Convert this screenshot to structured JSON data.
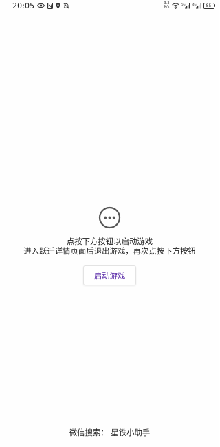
{
  "status_bar": {
    "time": "20:05",
    "net_speed_value": "3.3",
    "net_speed_unit": "K/s",
    "battery_level": "85",
    "icons": [
      "eye-icon",
      "nfc-icon",
      "location-icon",
      "mute-icon",
      "wifi-icon",
      "signal-icon",
      "signal-icon",
      "battery-icon"
    ],
    "signal_label_1": "5G",
    "signal_label_2": "4G"
  },
  "main": {
    "icon": "more-horizontal-circle-icon",
    "line1": "点按下方按钮以启动游戏",
    "line2": "进入跃迁详情页面后退出游戏，再次点按下方按钮",
    "start_button_label": "启动游戏",
    "accent_color": "#5a2aa8"
  },
  "footer": {
    "text": "微信搜索：  星铁小助手"
  }
}
